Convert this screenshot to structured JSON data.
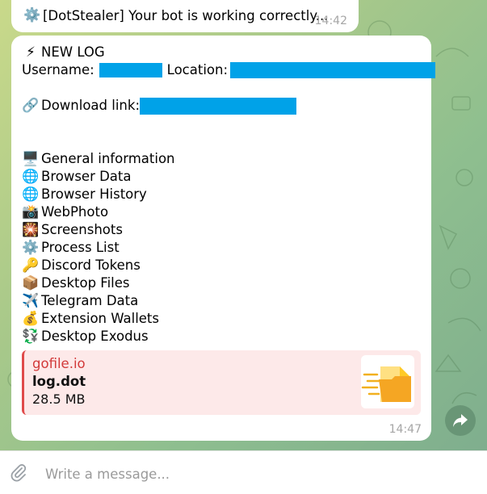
{
  "first_message": {
    "icon": "⚙️",
    "text": "[DotStealer] Your bot is working correctly...",
    "time": "14:42"
  },
  "log_message": {
    "header_icon": "⚡",
    "header": "NEW LOG",
    "username_label": "Username:",
    "location_label": "Location:",
    "download_icon": "🔗",
    "download_label": "Download link:",
    "items": [
      {
        "icon": "🖥️",
        "label": "General information"
      },
      {
        "icon": "🌐",
        "label": "Browser Data"
      },
      {
        "icon": "🌐",
        "label": "Browser History"
      },
      {
        "icon": "📸",
        "label": "WebPhoto"
      },
      {
        "icon": "🎇",
        "label": "Screenshots"
      },
      {
        "icon": "⚙️",
        "label": "Process List"
      },
      {
        "icon": "🔑",
        "label": "Discord Tokens"
      },
      {
        "icon": "📦",
        "label": "Desktop Files"
      },
      {
        "icon": "✈️",
        "label": "Telegram Data"
      },
      {
        "icon": "💰",
        "label": "Extension Wallets"
      },
      {
        "icon": "💱",
        "label": "Desktop Exodus"
      }
    ],
    "preview": {
      "site": "gofile.io",
      "file_name": "log.dot",
      "file_size": "28.5 MB"
    },
    "time": "14:47"
  },
  "composer": {
    "placeholder": "Write a message..."
  },
  "colors": {
    "redaction": "#00a2e8",
    "preview_accent": "#e04a4a",
    "preview_bg": "#fde9e9"
  }
}
